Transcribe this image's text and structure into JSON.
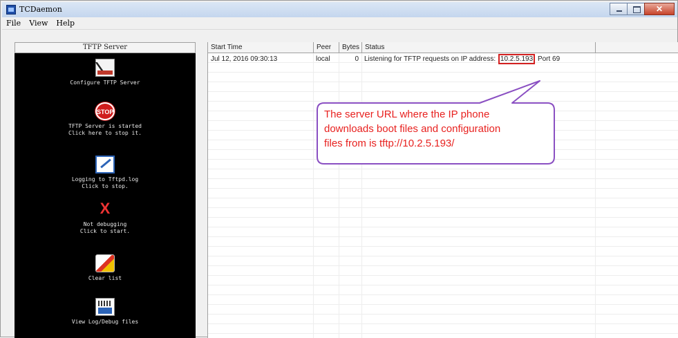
{
  "window": {
    "title": "TCDaemon",
    "controls": [
      "minimize-icon",
      "maximize-icon",
      "close-icon"
    ],
    "close_glyph": "✕"
  },
  "menu": {
    "items": [
      "File",
      "View",
      "Help"
    ]
  },
  "sidebar": {
    "header": "TFTP Server",
    "tools": [
      {
        "icon": "configure-server-icon",
        "lines": [
          "Configure TFTP Server"
        ]
      },
      {
        "icon": "stop-sign-icon",
        "icon_text": "STOP",
        "lines": [
          "TFTP Server is started",
          "Click here to stop it."
        ]
      },
      {
        "icon": "log-pen-icon",
        "lines": [
          "Logging to Tftpd.log",
          "Click to stop."
        ]
      },
      {
        "icon": "debug-x-icon",
        "icon_text": "X",
        "lines": [
          "Not debugging",
          "Click to start."
        ]
      },
      {
        "icon": "clear-list-icon",
        "lines": [
          "Clear list"
        ]
      },
      {
        "icon": "view-log-icon",
        "lines": [
          "View Log/Debug files"
        ]
      }
    ]
  },
  "log_table": {
    "columns": [
      "Start Time",
      "Peer",
      "Bytes",
      "Status"
    ],
    "rows": [
      {
        "start_time": "Jul 12, 2016 09:30:13",
        "peer": "local",
        "bytes": "0",
        "status_prefix": "Listening for TFTP requests on IP address:",
        "status_ip": "10.2.5.193",
        "status_suffix": "Port 69"
      }
    ]
  },
  "annotation": {
    "lines": [
      "The server URL where the IP phone",
      "downloads boot files and configuration",
      "files from is tftp://10.2.5.193/"
    ],
    "text_color": "#e8211f",
    "border_color": "#8a4fc2"
  },
  "colors": {
    "sidebar_bg": "#000000",
    "highlight_box": "#d42020"
  }
}
